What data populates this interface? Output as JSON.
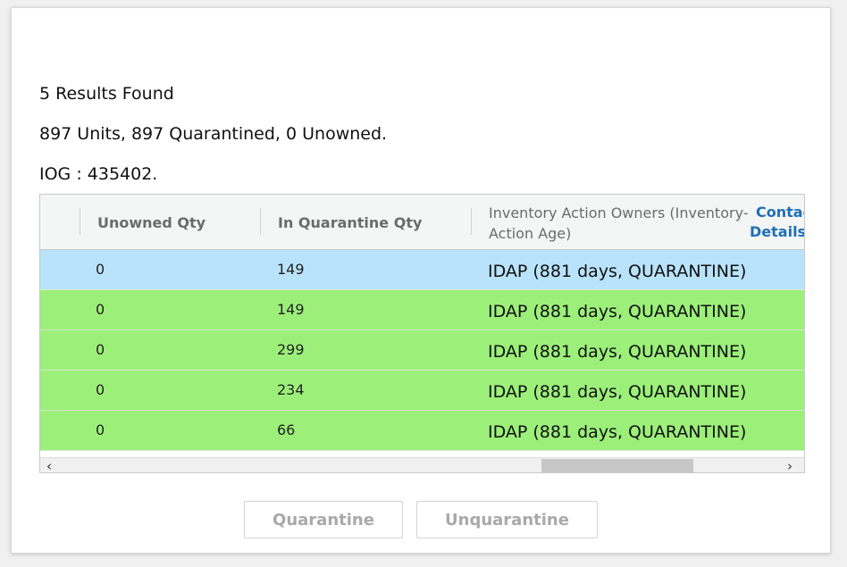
{
  "summary": {
    "results": "5 Results Found",
    "units": "897 Units, 897 Quarantined, 0 Unowned.",
    "iog": "IOG : 435402."
  },
  "table": {
    "columns": {
      "unowned_qty": "Unowned Qty",
      "in_quarantine_qty": "In Quarantine Qty",
      "owners_line1": "Inventory Action Owners (Inventory-",
      "owners_line2": "Action Age)",
      "contact_line1": "Contac",
      "contact_line2": "Details"
    },
    "rows": [
      {
        "unowned": "0",
        "quarantine": "149",
        "owner": "IDAP (881 days, QUARANTINE)",
        "selected": true
      },
      {
        "unowned": "0",
        "quarantine": "149",
        "owner": "IDAP (881 days, QUARANTINE)",
        "selected": false
      },
      {
        "unowned": "0",
        "quarantine": "299",
        "owner": "IDAP (881 days, QUARANTINE)",
        "selected": false
      },
      {
        "unowned": "0",
        "quarantine": "234",
        "owner": "IDAP (881 days, QUARANTINE)",
        "selected": false
      },
      {
        "unowned": "0",
        "quarantine": "66",
        "owner": "IDAP (881 days, QUARANTINE)",
        "selected": false
      }
    ],
    "colors": {
      "selected_row": "#b9e3fb",
      "row": "#9cf07a",
      "link": "#1f6fb5"
    }
  },
  "scrollbar": {
    "left_arrow": "‹",
    "right_arrow": "›"
  },
  "buttons": {
    "quarantine": "Quarantine",
    "unquarantine": "Unquarantine"
  }
}
